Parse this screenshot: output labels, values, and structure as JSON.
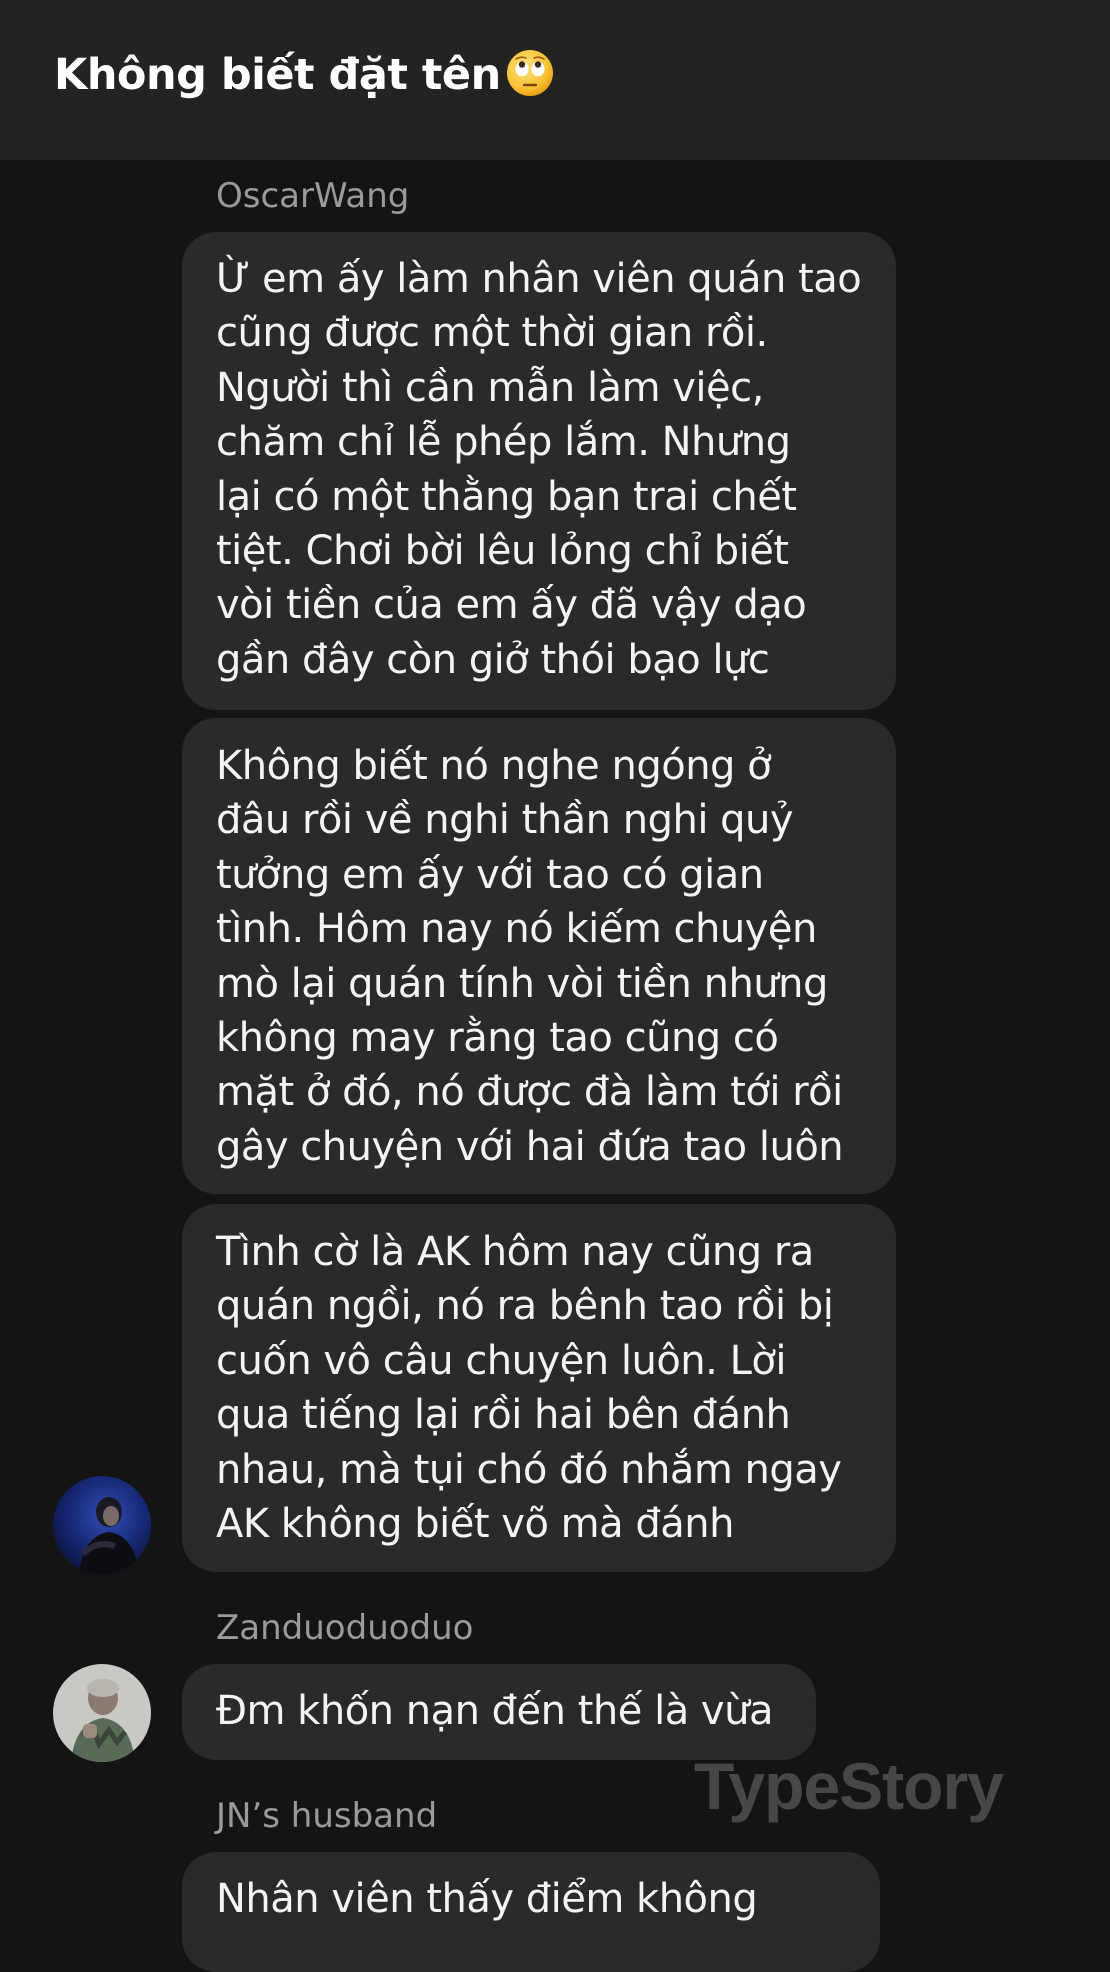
{
  "header": {
    "title": "Không biết đặt tên",
    "emoji": "face-with-rolling-eyes-icon"
  },
  "messages": [
    {
      "sender": "OscarWang",
      "bubbles": [
        {
          "lines": [
            "Ừ em ấy làm nhân viên quán tao",
            "cũng được một thời gian rồi.",
            "Người thì cần mẫn làm việc,",
            "chăm chỉ lễ phép lắm. Nhưng",
            "lại có một thằng bạn trai chết",
            "tiệt. Chơi bời lêu lỏng chỉ biết",
            "vòi tiền của em ấy đã vậy dạo",
            "gần đây còn giở thói bạo lực"
          ]
        },
        {
          "lines": [
            "Không biết nó nghe ngóng ở",
            "đâu rồi về nghi thần nghi quỷ",
            "tưởng em ấy với tao có gian",
            "tình. Hôm nay nó kiếm chuyện",
            "mò lại quán tính vòi tiền nhưng",
            "không may rằng tao cũng có",
            "mặt ở đó, nó được đà làm tới rồi",
            "gây chuyện với hai đứa tao luôn"
          ]
        },
        {
          "lines": [
            "Tình cờ là AK hôm nay cũng ra",
            "quán ngồi, nó ra bênh tao rồi bị",
            "cuốn vô câu chuyện luôn. Lời",
            "qua tiếng lại rồi hai bên đánh",
            "nhau, mà tụi chó đó nhắm ngay",
            "AK không biết võ mà đánh"
          ]
        }
      ]
    },
    {
      "sender": "Zanduoduoduo",
      "bubbles": [
        {
          "lines": [
            "Đm khốn nạn đến thế là vừa"
          ]
        }
      ]
    },
    {
      "sender": "JN’s husband",
      "bubbles": [
        {
          "lines": [
            "Nhân viên thấy điểm không"
          ]
        }
      ]
    }
  ],
  "watermark": "TypeStory",
  "colors": {
    "background": "#141414",
    "header": "#232323",
    "bubble": "#2a2a2c",
    "sender": "#9a9a9a"
  }
}
